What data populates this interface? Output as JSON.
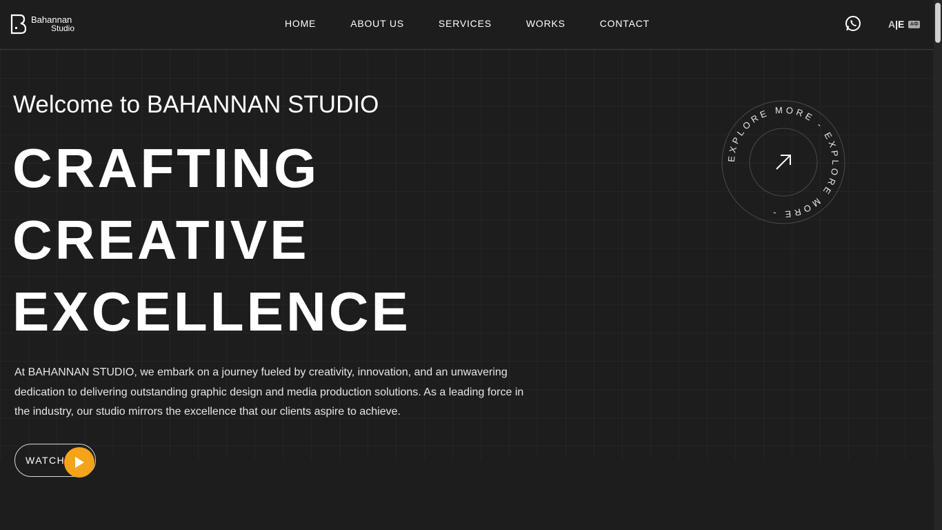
{
  "brand": {
    "line1": "Bahannan",
    "line2": "Studio"
  },
  "nav": {
    "items": [
      {
        "label": "HOME"
      },
      {
        "label": "ABOUT US"
      },
      {
        "label": "SERVICES"
      },
      {
        "label": "WORKS"
      },
      {
        "label": "CONTACT"
      }
    ]
  },
  "header": {
    "whatsapp_icon": "whatsapp-icon",
    "lang": {
      "left": "A",
      "sep": "|",
      "right": "E",
      "kbd": "A中"
    }
  },
  "hero": {
    "welcome": "Welcome to BAHANNAN STUDIO",
    "headline": [
      "CRAFTING",
      "CREATIVE",
      "EXCELLENCE"
    ],
    "description": "At BAHANNAN STUDIO, we embark on a journey fueled by creativity, innovation, and an unwavering dedication to delivering outstanding graphic design and media production solutions. As a leading force in the industry, our studio mirrors the excellence that our clients aspire to achieve.",
    "watch_label": "WATCH",
    "explore_text": "EXPLORE MORE - EXPLORE MORE - "
  },
  "colors": {
    "background": "#1d1d1d",
    "accent": "#f5a31a",
    "text": "#ffffff"
  }
}
